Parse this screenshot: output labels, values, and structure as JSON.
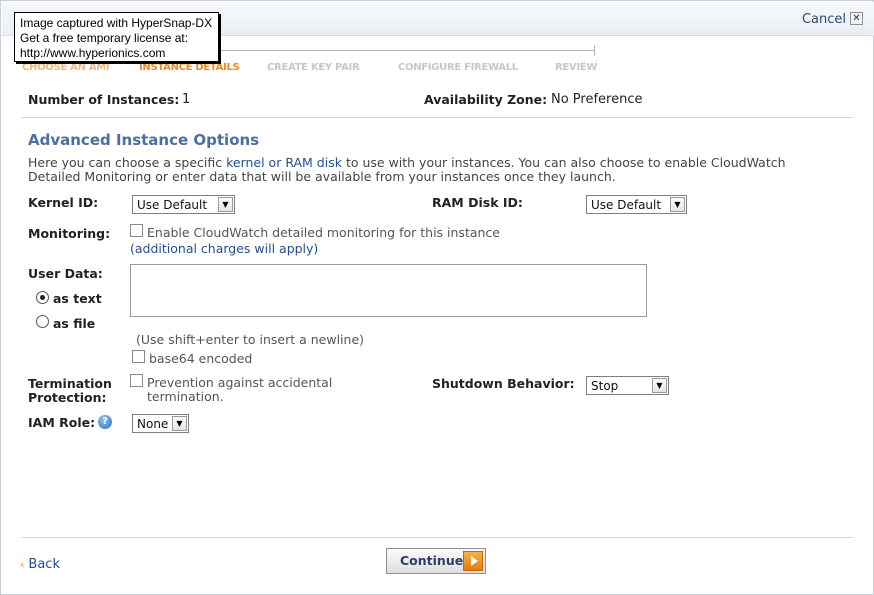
{
  "header": {
    "cancel_label": "Cancel",
    "close_glyph": "✕"
  },
  "tooltip": {
    "lines": [
      "Image captured with HyperSnap-DX",
      "Get a free temporary license at:",
      "http://www.hyperionics.com"
    ]
  },
  "wizard": {
    "steps": [
      "CHOOSE AN AMI",
      "INSTANCE DETAILS",
      "CREATE KEY PAIR",
      "CONFIGURE FIREWALL",
      "REVIEW"
    ],
    "active_index": 1
  },
  "instances": {
    "number_label": "Number of Instances:",
    "number_value": "1",
    "zone_label": "Availability Zone:",
    "zone_value": "No Preference"
  },
  "advanced": {
    "title": "Advanced Instance Options",
    "desc_part1": "Here you can choose a specific ",
    "desc_link": "kernel or RAM disk",
    "desc_part2": " to use with your instances. You can also choose to enable CloudWatch Detailed Monitoring or enter data that will be available from your instances once they launch.",
    "kernel_label": "Kernel ID:",
    "kernel_value": "Use Default",
    "ramdisk_label": "RAM Disk ID:",
    "ramdisk_value": "Use Default",
    "monitoring_label": "Monitoring:",
    "monitoring_text": "Enable CloudWatch detailed monitoring for this instance",
    "monitoring_link": "(additional charges will apply)",
    "userdata_label": "User Data:",
    "as_text_label": "as text",
    "as_file_label": "as file",
    "newline_hint": "(Use shift+enter to insert a newline)",
    "base64_label": "base64 encoded",
    "termination_label_1": "Termination",
    "termination_label_2": "Protection:",
    "termination_text_1": "Prevention against accidental",
    "termination_text_2": "termination.",
    "shutdown_label": "Shutdown Behavior:",
    "shutdown_value": "Stop",
    "iam_label": "IAM Role:",
    "iam_value": "None"
  },
  "footer": {
    "back_label": "Back",
    "continue_label": "Continue"
  }
}
